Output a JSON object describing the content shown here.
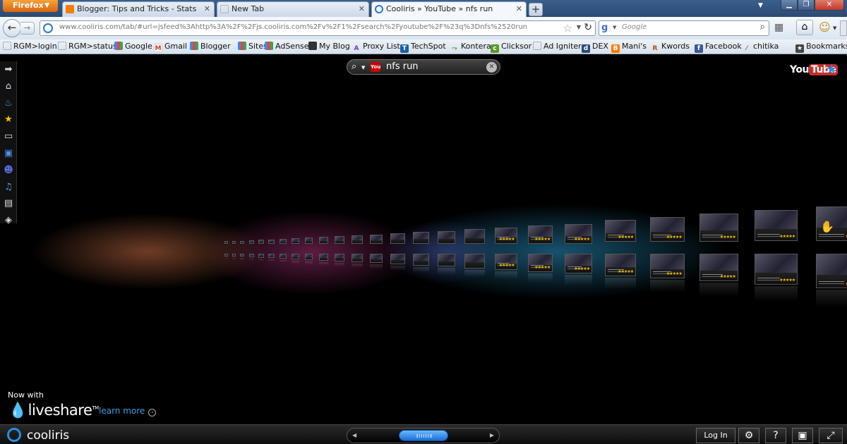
{
  "browser": {
    "menu_label": "Firefox",
    "tabs": [
      {
        "title": "Blogger: Tips and Tricks - Stats",
        "active": false
      },
      {
        "title": "New Tab",
        "active": false
      },
      {
        "title": "Cooliris » YouTube » nfs run",
        "active": true
      }
    ],
    "url": "www.cooliris.com/tab/#url=jsfeed%3Ahttp%3A%2F%2Fjs.cooliris.com%2Fv%2F1%2Fsearch%2Fyoutube%2F%23q%3Dnfs%2520run",
    "search_placeholder": "Google",
    "bookmarks": [
      {
        "label": "RGM>login",
        "icon": "page-icon"
      },
      {
        "label": "RGM>status",
        "icon": "page-icon"
      },
      {
        "label": "Google",
        "icon": "google-icon"
      },
      {
        "label": "Gmail",
        "icon": "gmail-icon"
      },
      {
        "label": "Blogger",
        "icon": "google-icon"
      },
      {
        "label": "Sites",
        "icon": "google-icon"
      },
      {
        "label": "AdSense",
        "icon": "google-icon"
      },
      {
        "label": "My Blog",
        "icon": "grid-icon"
      },
      {
        "label": "Proxy List",
        "icon": "az-icon"
      },
      {
        "label": "TechSpot",
        "icon": "ts-icon"
      },
      {
        "label": "Kontera",
        "icon": "kontera-icon"
      },
      {
        "label": "Clicksor",
        "icon": "clicksor-icon"
      },
      {
        "label": "Ad Igniter",
        "icon": "page-icon"
      },
      {
        "label": "DEX",
        "icon": "dex-icon"
      },
      {
        "label": "Mani's",
        "icon": "blogger-icon"
      },
      {
        "label": "Kwords",
        "icon": "kwords-icon"
      },
      {
        "label": "Facebook",
        "icon": "facebook-icon"
      },
      {
        "label": "chitika",
        "icon": "chitika-icon"
      },
      {
        "label": "Bookmarks",
        "icon": "bookmarks-icon"
      }
    ]
  },
  "cooliris": {
    "search_query": "nfs run",
    "source_logo": {
      "you": "You",
      "tube": "Tube"
    },
    "sidebar_icons": [
      "arrow-icon",
      "home-icon",
      "flame-icon",
      "star-icon",
      "monitor-icon",
      "tv-icon",
      "masks-icon",
      "music-icon",
      "film-icon",
      "gamepad-icon"
    ],
    "promo": {
      "now_with": "Now with",
      "brand": "liveshare",
      "tm": "TM",
      "learn_more": "learn more"
    },
    "bottom": {
      "brand": "cooliris",
      "login": "Log In"
    }
  },
  "colors": {
    "accent": "#2a8ce8",
    "youtube_red": "#c4302b",
    "firefox_orange": "#e87a1a"
  }
}
